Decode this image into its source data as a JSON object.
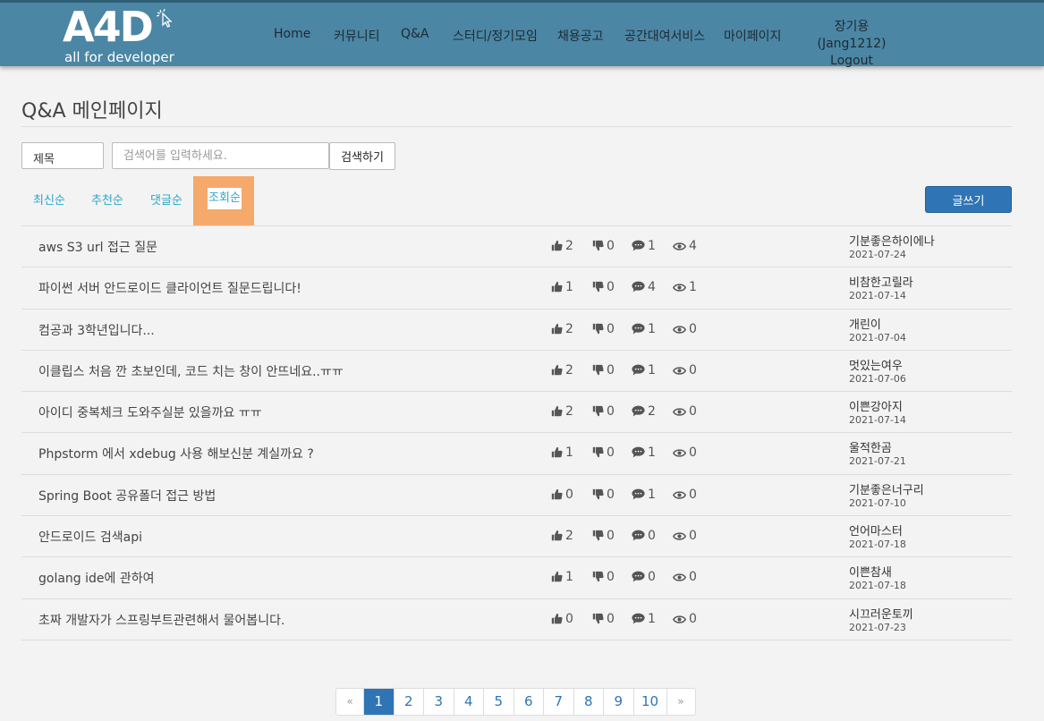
{
  "header": {
    "logo_text": "A4D",
    "logo_sub": "all for developer",
    "nav": [
      "Home",
      "커뮤니티",
      "Q&A",
      "스터디/정기모임",
      "채용공고",
      "공간대여서비스",
      "마이페이지"
    ],
    "user": "장기용(Jang1212)",
    "logout": "Logout"
  },
  "page_title": "Q&A 메인페이지",
  "search": {
    "field_select": "제목",
    "placeholder": "검색어를 입력하세요.",
    "button": "검색하기"
  },
  "sort_tabs": [
    "최신순",
    "추천순",
    "댓글순",
    "조회순"
  ],
  "active_sort": "조회순",
  "write_button": "글쓰기",
  "posts": [
    {
      "title": "aws S3 url 접근 질문",
      "likes": "2",
      "dislikes": "0",
      "comments": "1",
      "views": "4",
      "author": "기분좋은하이에나",
      "date": "2021-07-24"
    },
    {
      "title": "파이썬 서버 안드로이드 클라이언트 질문드립니다!",
      "likes": "1",
      "dislikes": "0",
      "comments": "4",
      "views": "1",
      "author": "비참한고릴라",
      "date": "2021-07-14"
    },
    {
      "title": "컴공과 3학년입니다...",
      "likes": "2",
      "dislikes": "0",
      "comments": "1",
      "views": "0",
      "author": "개린이",
      "date": "2021-07-04"
    },
    {
      "title": "이클립스 처음 깐 초보인데, 코드 치는 창이 안뜨네요..ㅠㅠ",
      "likes": "2",
      "dislikes": "0",
      "comments": "1",
      "views": "0",
      "author": "멋있는여우",
      "date": "2021-07-06"
    },
    {
      "title": "아이디 중복체크 도와주실분 있을까요 ㅠㅠ",
      "likes": "2",
      "dislikes": "0",
      "comments": "2",
      "views": "0",
      "author": "이쁜강아지",
      "date": "2021-07-14"
    },
    {
      "title": "Phpstorm 에서 xdebug 사용 해보신분 계실까요 ?",
      "likes": "1",
      "dislikes": "0",
      "comments": "1",
      "views": "0",
      "author": "울적한곰",
      "date": "2021-07-21"
    },
    {
      "title": "Spring Boot 공유폴더 접근 방법",
      "likes": "0",
      "dislikes": "0",
      "comments": "1",
      "views": "0",
      "author": "기분좋은너구리",
      "date": "2021-07-10"
    },
    {
      "title": "안드로이드 검색api",
      "likes": "2",
      "dislikes": "0",
      "comments": "0",
      "views": "0",
      "author": "언어마스터",
      "date": "2021-07-18"
    },
    {
      "title": "golang ide에 관하여",
      "likes": "1",
      "dislikes": "0",
      "comments": "0",
      "views": "0",
      "author": "이쁜참새",
      "date": "2021-07-18"
    },
    {
      "title": "초짜 개발자가 스프링부트관련해서 물어봅니다.",
      "likes": "0",
      "dislikes": "0",
      "comments": "1",
      "views": "0",
      "author": "시끄러운토끼",
      "date": "2021-07-23"
    }
  ],
  "pagination": {
    "prev": "«",
    "pages": [
      "1",
      "2",
      "3",
      "4",
      "5",
      "6",
      "7",
      "8",
      "9",
      "10"
    ],
    "current": "1",
    "next": "»"
  },
  "icons": {
    "likes": "thumbs-up-icon",
    "dislikes": "thumbs-down-icon",
    "comments": "comment-icon",
    "views": "eye-icon"
  },
  "colors": {
    "header_bg": "#4b86a4",
    "accent_blue": "#2f74b5",
    "sort_link": "#2aa6c9",
    "active_sort_highlight": "#f5a96b"
  }
}
